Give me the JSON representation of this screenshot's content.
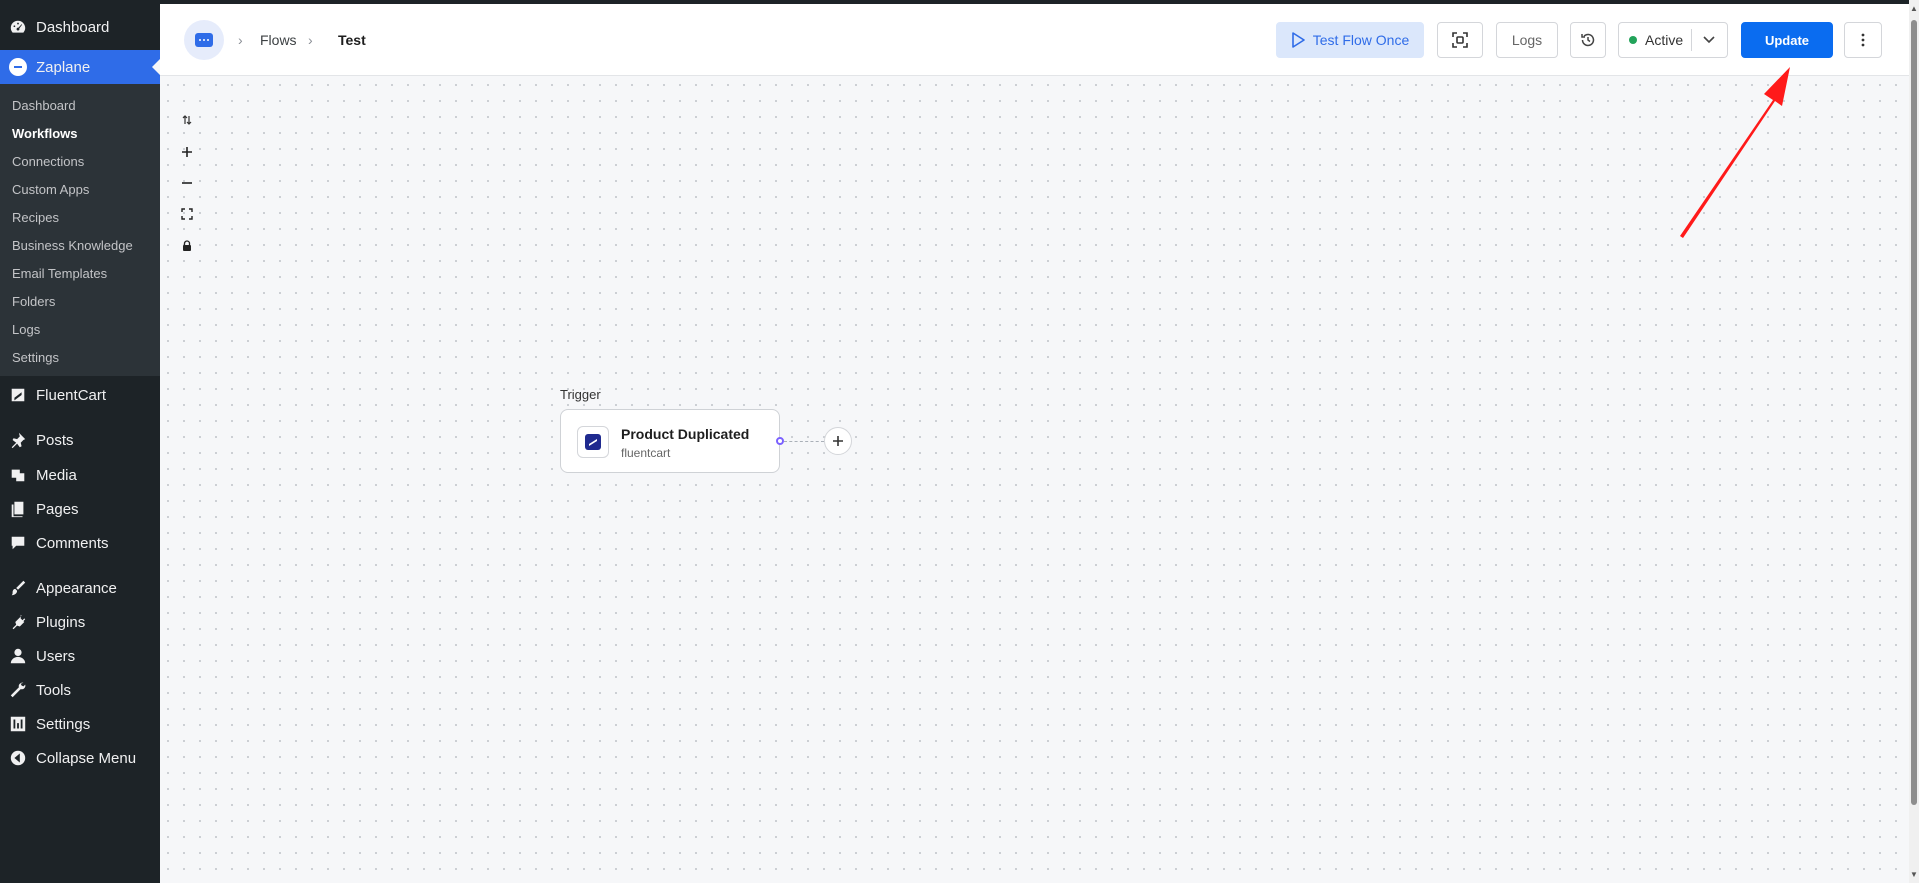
{
  "sidebar": {
    "top_items": [
      {
        "label": "Dashboard",
        "icon": "dashboard-icon"
      },
      {
        "label": "Zaplane",
        "icon": "zaplane-logo-icon"
      }
    ],
    "submenu": [
      "Dashboard",
      "Workflows",
      "Connections",
      "Custom Apps",
      "Recipes",
      "Business Knowledge",
      "Email Templates",
      "Folders",
      "Logs",
      "Settings"
    ],
    "submenu_current": "Workflows",
    "bottom_items": [
      {
        "label": "FluentCart",
        "icon": "fluentcart-icon"
      },
      {
        "label": "Posts",
        "icon": "pin-icon"
      },
      {
        "label": "Media",
        "icon": "media-icon"
      },
      {
        "label": "Pages",
        "icon": "pages-icon"
      },
      {
        "label": "Comments",
        "icon": "comment-icon"
      },
      {
        "label": "Appearance",
        "icon": "brush-icon"
      },
      {
        "label": "Plugins",
        "icon": "plug-icon"
      },
      {
        "label": "Users",
        "icon": "user-icon"
      },
      {
        "label": "Tools",
        "icon": "wrench-icon"
      },
      {
        "label": "Settings",
        "icon": "settings-sliders-icon"
      },
      {
        "label": "Collapse Menu",
        "icon": "collapse-icon"
      }
    ]
  },
  "header": {
    "breadcrumb": [
      "Flows",
      "Test"
    ],
    "test_flow_label": "Test Flow Once",
    "logs_label": "Logs",
    "status_label": "Active",
    "update_label": "Update"
  },
  "canvas": {
    "trigger_label": "Trigger",
    "node": {
      "title": "Product Duplicated",
      "subtitle": "fluentcart"
    }
  },
  "colors": {
    "accent": "#2f6ce8",
    "update_button": "#0a6cf0",
    "status_active": "#22a35a",
    "annotation_arrow": "#ff1a1a"
  }
}
